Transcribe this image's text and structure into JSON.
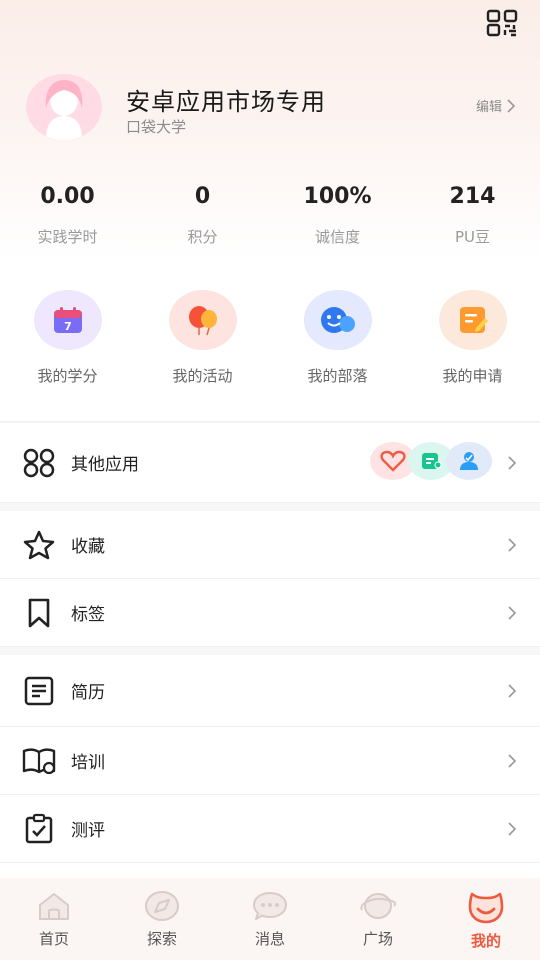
{
  "header": {
    "username": "安卓应用市场专用",
    "school": "口袋大学",
    "edit_label": "编辑"
  },
  "stats": [
    {
      "value": "0.00",
      "label": "实践学时"
    },
    {
      "value": "0",
      "label": "积分"
    },
    {
      "value": "100%",
      "label": "诚信度"
    },
    {
      "value": "214",
      "label": "PU豆"
    }
  ],
  "quick_actions": [
    {
      "label": "我的学分",
      "icon": "calendar-icon",
      "calendar_day": "7"
    },
    {
      "label": "我的活动",
      "icon": "balloons-icon"
    },
    {
      "label": "我的部落",
      "icon": "tribe-face-icon"
    },
    {
      "label": "我的申请",
      "icon": "application-edit-icon"
    }
  ],
  "menu": [
    {
      "label": "其他应用",
      "icon": "apps-grid-icon"
    },
    {
      "label": "收藏",
      "icon": "star-icon"
    },
    {
      "label": "标签",
      "icon": "bookmark-icon"
    },
    {
      "label": "简历",
      "icon": "resume-icon"
    },
    {
      "label": "培训",
      "icon": "book-training-icon"
    },
    {
      "label": "测评",
      "icon": "clipboard-check-icon"
    }
  ],
  "tabs": [
    {
      "label": "首页",
      "icon": "home-icon"
    },
    {
      "label": "探索",
      "icon": "compass-icon"
    },
    {
      "label": "消息",
      "icon": "chat-bubble-icon"
    },
    {
      "label": "广场",
      "icon": "planet-icon"
    },
    {
      "label": "我的",
      "icon": "smile-face-icon",
      "active": true
    }
  ],
  "colors": {
    "accent": "#ee5a3d",
    "avatar_bg": "#ffdbe5"
  }
}
